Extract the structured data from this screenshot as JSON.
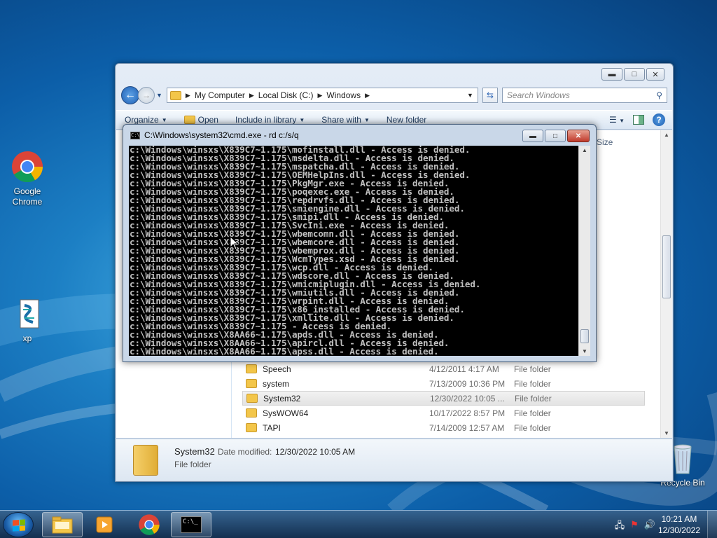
{
  "desktop": {
    "icons": [
      {
        "label_line1": "Google",
        "label_line2": "Chrome"
      },
      {
        "label_line1": "xp",
        "label_line2": ""
      },
      {
        "label_line1": "Recycle Bin",
        "label_line2": ""
      }
    ]
  },
  "explorer": {
    "address": {
      "crumbs": [
        "My Computer",
        "Local Disk (C:)",
        "Windows"
      ]
    },
    "search_placeholder": "Search Windows",
    "toolbar": {
      "organize": "Organize",
      "open": "Open",
      "include": "Include in library",
      "share": "Share with",
      "new_folder": "New folder"
    },
    "column_size": "Size",
    "files": [
      {
        "name": "Speech",
        "date": "4/12/2011 4:17 AM",
        "type": "File folder"
      },
      {
        "name": "system",
        "date": "7/13/2009 10:36 PM",
        "type": "File folder"
      },
      {
        "name": "System32",
        "date": "12/30/2022 10:05 ...",
        "type": "File folder"
      },
      {
        "name": "SysWOW64",
        "date": "10/17/2022 8:57 PM",
        "type": "File folder"
      },
      {
        "name": "TAPI",
        "date": "7/14/2009 12:57 AM",
        "type": "File folder"
      }
    ],
    "selected_index": 2,
    "details": {
      "name": "System32",
      "date_label": "Date modified:",
      "date_value": "12/30/2022 10:05 AM",
      "type": "File folder"
    }
  },
  "cmd": {
    "title": "C:\\Windows\\system32\\cmd.exe - rd  c:/s/q",
    "lines": [
      "c:\\Windows\\winsxs\\X839C7~1.175\\mofinstall.dll - Access is denied.",
      "c:\\Windows\\winsxs\\X839C7~1.175\\msdelta.dll - Access is denied.",
      "c:\\Windows\\winsxs\\X839C7~1.175\\mspatcha.dll - Access is denied.",
      "c:\\Windows\\winsxs\\X839C7~1.175\\OEMHelpIns.dll - Access is denied.",
      "c:\\Windows\\winsxs\\X839C7~1.175\\PkgMgr.exe - Access is denied.",
      "c:\\Windows\\winsxs\\X839C7~1.175\\poqexec.exe - Access is denied.",
      "c:\\Windows\\winsxs\\X839C7~1.175\\repdrvfs.dll - Access is denied.",
      "c:\\Windows\\winsxs\\X839C7~1.175\\smiengine.dll - Access is denied.",
      "c:\\Windows\\winsxs\\X839C7~1.175\\smipi.dll - Access is denied.",
      "c:\\Windows\\winsxs\\X839C7~1.175\\SvcIni.exe - Access is denied.",
      "c:\\Windows\\winsxs\\X839C7~1.175\\wbemcomn.dll - Access is denied.",
      "c:\\Windows\\winsxs\\X839C7~1.175\\wbemcore.dll - Access is denied.",
      "c:\\Windows\\winsxs\\X839C7~1.175\\wbemprox.dll - Access is denied.",
      "c:\\Windows\\winsxs\\X839C7~1.175\\WcmTypes.xsd - Access is denied.",
      "c:\\Windows\\winsxs\\X839C7~1.175\\wcp.dll - Access is denied.",
      "c:\\Windows\\winsxs\\X839C7~1.175\\wdscore.dll - Access is denied.",
      "c:\\Windows\\winsxs\\X839C7~1.175\\wmicmiplugin.dll - Access is denied.",
      "c:\\Windows\\winsxs\\X839C7~1.175\\wmiutils.dll - Access is denied.",
      "c:\\Windows\\winsxs\\X839C7~1.175\\wrpint.dll - Access is denied.",
      "c:\\Windows\\winsxs\\X839C7~1.175\\x86_installed - Access is denied.",
      "c:\\Windows\\winsxs\\X839C7~1.175\\xmllite.dll - Access is denied.",
      "c:\\Windows\\winsxs\\X839C7~1.175 - Access is denied.",
      "c:\\Windows\\winsxs\\X8AA66~1.175\\apds.dll - Access is denied.",
      "c:\\Windows\\winsxs\\X8AA66~1.175\\apircl.dll - Access is denied.",
      "c:\\Windows\\winsxs\\X8AA66~1.175\\apss.dll - Access is denied."
    ]
  },
  "taskbar": {
    "time": "10:21 AM",
    "date": "12/30/2022",
    "cmd_icon_text": "C:\\_"
  }
}
